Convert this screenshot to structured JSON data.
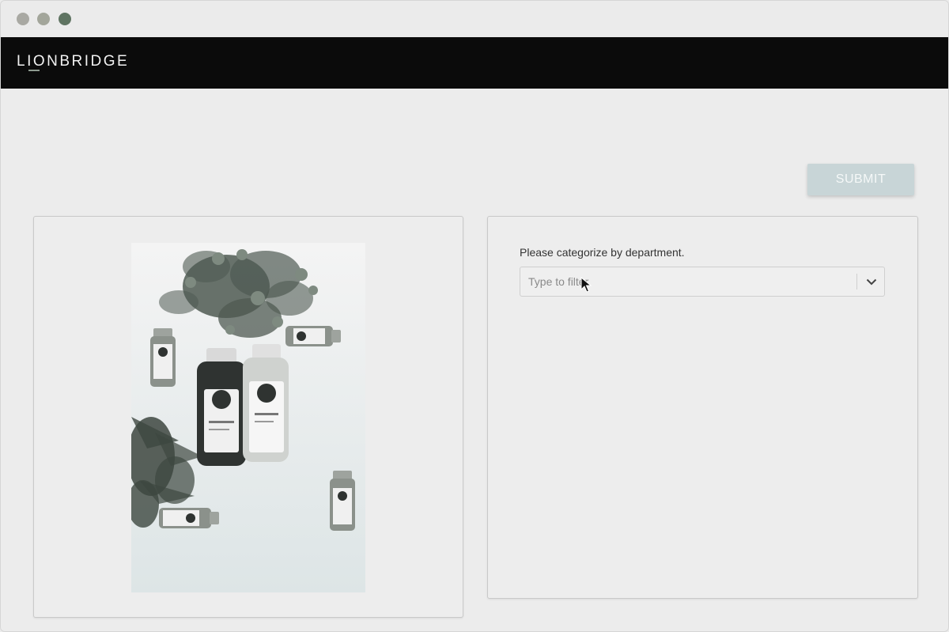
{
  "brand": {
    "name": "LIONBRIDGE"
  },
  "toolbar": {
    "submit_label": "SUBMIT"
  },
  "task": {
    "prompt": "Please categorize by department.",
    "filter_placeholder": "Type to filter",
    "filter_value": ""
  },
  "image": {
    "alt": "Photo of juice bottles with green plants on a white surface"
  },
  "colors": {
    "appbar": "#0b0b0b",
    "submit_button": "#c8d5d7",
    "background": "#ececec"
  }
}
